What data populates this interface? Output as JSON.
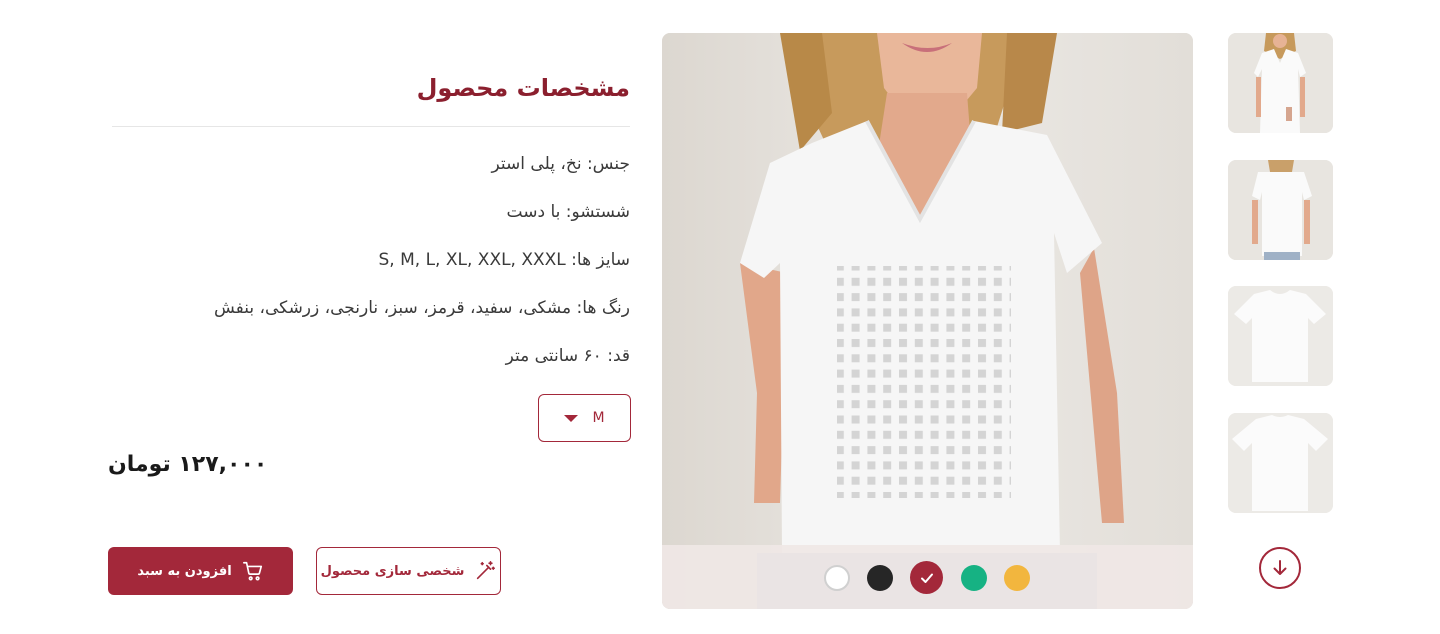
{
  "specs": {
    "title": "مشخصات محصول",
    "rows": [
      "جنس: نخ، پلی استر",
      "شستشو: با دست",
      "سایز ها: S, M, L, XL, XXL, XXXL",
      "رنگ ها: مشکی، سفید، قرمز، سبز، نارنجی، زرشکی، بنفش",
      "قد: ۶۰ سانتی متر"
    ]
  },
  "size_select": {
    "value": "M"
  },
  "price": "۱۲۷,۰۰۰ تومان",
  "buttons": {
    "add_to_cart": "افزودن به سبد",
    "customize": "شخصی سازی محصول"
  },
  "colors": {
    "accent": "#a3283a",
    "swatches": [
      "#ffffff",
      "#262626",
      "#a3283a",
      "#16b283",
      "#f2b63e"
    ],
    "selected_swatch": "#a3283a"
  },
  "icons": [
    "cart-icon",
    "magic-wand-icon",
    "chevron-down-icon",
    "check-icon",
    "arrow-down-icon"
  ]
}
